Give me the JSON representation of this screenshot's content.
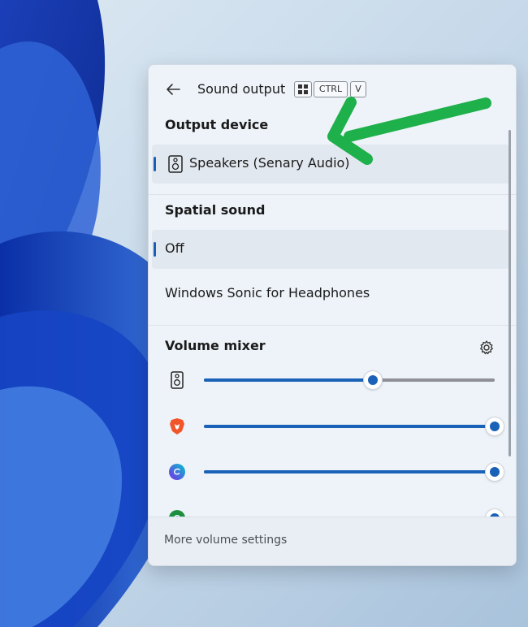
{
  "panel": {
    "title": "Sound output",
    "shortcut_keys": [
      "CTRL",
      "V"
    ]
  },
  "output_device": {
    "heading": "Output device",
    "devices": [
      {
        "label": "Speakers (Senary Audio)",
        "selected": true
      }
    ]
  },
  "spatial_sound": {
    "heading": "Spatial sound",
    "options": [
      {
        "label": "Off",
        "selected": true
      },
      {
        "label": "Windows Sonic for Headphones",
        "selected": false
      }
    ]
  },
  "volume_mixer": {
    "heading": "Volume mixer",
    "apps": [
      {
        "icon": "speaker-icon",
        "level": 0.58
      },
      {
        "icon": "brave-browser-icon",
        "level": 1.0
      },
      {
        "icon": "canva-icon",
        "level": 1.0
      },
      {
        "icon": "chrome-icon",
        "level": 1.0
      }
    ]
  },
  "footer": {
    "link": "More volume settings"
  },
  "colors": {
    "accent": "#1a62b8",
    "annotation_arrow": "#1eb04a"
  }
}
